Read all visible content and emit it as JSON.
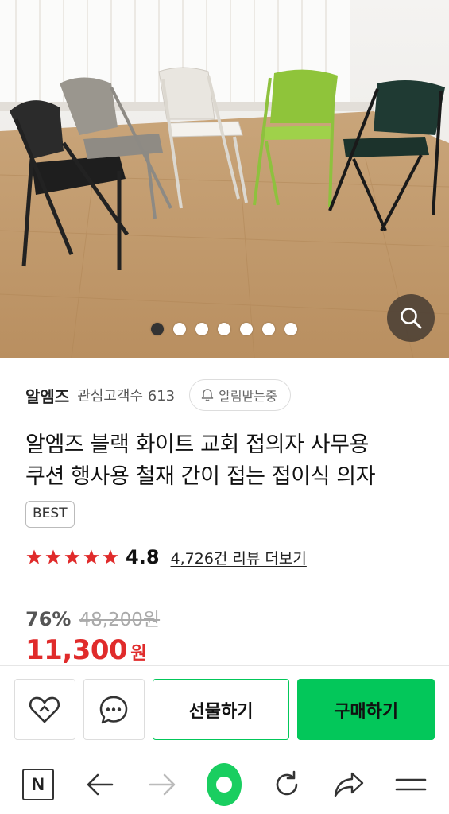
{
  "hero": {
    "dots": 7,
    "active_dot": 0,
    "icons": {
      "zoom": "search-icon"
    }
  },
  "store": {
    "name": "알엠즈",
    "fav_label": "관심고객수 613",
    "alarm_label": "알림받는중",
    "alarm_icon": "bell-icon"
  },
  "product": {
    "title_line1": "알엠즈 블랙 화이트 교회 접의자 사무용",
    "title_line2": "쿠션 행사용 철재 간이 접는 접이식 의자",
    "badge": "BEST"
  },
  "rating": {
    "stars": 5,
    "value": "4.8",
    "review_link": "4,726건 리뷰 더보기",
    "star_color": "#e02b2b"
  },
  "price": {
    "discount": "76%",
    "original": "48,200원",
    "sale": "11,300",
    "currency": "원",
    "sale_color": "#e02b2b"
  },
  "actions": {
    "wishlist_icon": "heart-icon",
    "chat_icon": "chat-bubble-icon",
    "gift_label": "선물하기",
    "buy_label": "구매하기",
    "accent": "#03c75a"
  },
  "browser_nav": {
    "logo_letter": "N",
    "items": [
      "naver-logo-icon",
      "back-arrow-icon",
      "forward-arrow-icon",
      "home-icon",
      "refresh-icon",
      "share-icon",
      "menu-icon"
    ]
  }
}
